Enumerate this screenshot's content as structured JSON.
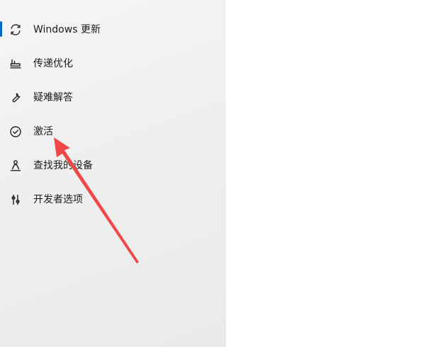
{
  "sidebar": {
    "items": [
      {
        "label": "Windows 更新",
        "icon": "refresh-icon",
        "active": true
      },
      {
        "label": "传递优化",
        "icon": "delivery-optimization-icon",
        "active": false
      },
      {
        "label": "疑难解答",
        "icon": "wrench-icon",
        "active": false
      },
      {
        "label": "激活",
        "icon": "check-circle-icon",
        "active": false
      },
      {
        "label": "查找我的设备",
        "icon": "person-location-icon",
        "active": false
      },
      {
        "label": "开发者选项",
        "icon": "developer-sliders-icon",
        "active": false
      }
    ]
  },
  "colors": {
    "accent": "#0067c0",
    "annotation_arrow": "#f04848",
    "text": "#1b1b1b",
    "sidebar_background": "#efefef"
  },
  "annotation": {
    "type": "arrow",
    "points_to": "激活"
  }
}
